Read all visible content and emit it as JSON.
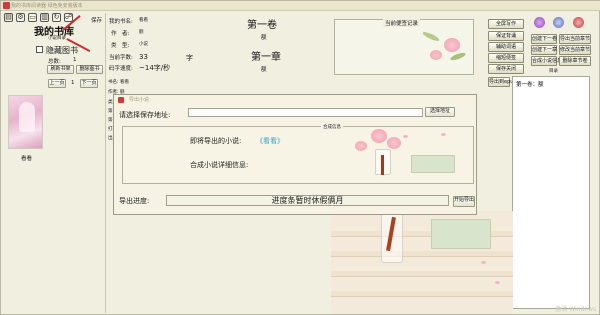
{
  "window": {
    "title_text": "我的书库阅读器 绿色免安装版本",
    "watermark": "激活 Windows"
  },
  "toolbar": {
    "icons": [
      "bookshelf-icon",
      "settings-icon",
      "folder-icon",
      "book-icon",
      "refresh-icon",
      "share-icon"
    ],
    "save_label": "保存"
  },
  "library": {
    "title": "我的书库",
    "subtitle": "小说目录",
    "hide_books_label": "隐藏图书",
    "count_label": "总数:",
    "count_value": "1",
    "refresh_button": "刷新书架",
    "delete_button": "删除图书",
    "prev_button": "上一页",
    "page_number": "1",
    "next_button": "下一页",
    "cover_caption": "看看"
  },
  "book_info": {
    "name_label": "我的书名:",
    "name_value": "看看",
    "author_label": "作　者:",
    "author_value": "额",
    "type_label": "类　型:",
    "type_value": "小说",
    "words_label": "当前字数:",
    "words_value": "33",
    "words_unit": "字",
    "speed_label": "码字速度:",
    "speed_value": "~14字/秒",
    "volume_title": "第一卷",
    "volume_sub": "额",
    "chapter_title": "第一章",
    "chapter_sub": "额"
  },
  "side_info": {
    "title_label": "书名:",
    "title_value": "看看",
    "author_label": "作者:",
    "author_value": "额",
    "type_label": "类型:",
    "type_value": "小说",
    "row4": "第一",
    "row5": "第一",
    "row6": "打开",
    "row7": "出版"
  },
  "notes": {
    "title": "当前便签记录"
  },
  "right_buttons": [
    {
      "label": "全屏写作",
      "name": "fullscreen-write-button"
    },
    {
      "label": "保证背诵",
      "name": "memorize-button"
    },
    {
      "label": "辅助词语",
      "name": "helper-words-button"
    },
    {
      "label": "缩短便签",
      "name": "shorten-notes-button"
    },
    {
      "label": "保存关闭",
      "name": "save-close-button"
    }
  ],
  "chapter_buttons": [
    {
      "label": "创建下一卷",
      "name": "create-next-volume-button"
    },
    {
      "label": "导出当前章节",
      "name": "export-chapter-button"
    },
    {
      "label": "创建下一章",
      "name": "create-next-chapter-button"
    },
    {
      "label": "修改当前章节",
      "name": "edit-chapter-button"
    },
    {
      "label": "合成小说信息",
      "name": "compose-novel-button"
    },
    {
      "label": "删除章节卷",
      "name": "delete-chapter-button"
    },
    {
      "label": "导出到epub",
      "name": "export-epub-button"
    }
  ],
  "tree": {
    "header": "目录",
    "node": "第一卷：额"
  },
  "dialog": {
    "title": "导出小说",
    "save_path_label": "请选择保存地址:",
    "save_path_value": "",
    "choose_button": "选择地址",
    "compose_group": "合成信息",
    "novel_label": "即将导出的小说:",
    "novel_value": "《看看》",
    "detail_label": "合成小说详细信息:",
    "progress_label": "导出进度:",
    "progress_text": "进度条暂时休假俩月",
    "start_button": "开始导出"
  }
}
